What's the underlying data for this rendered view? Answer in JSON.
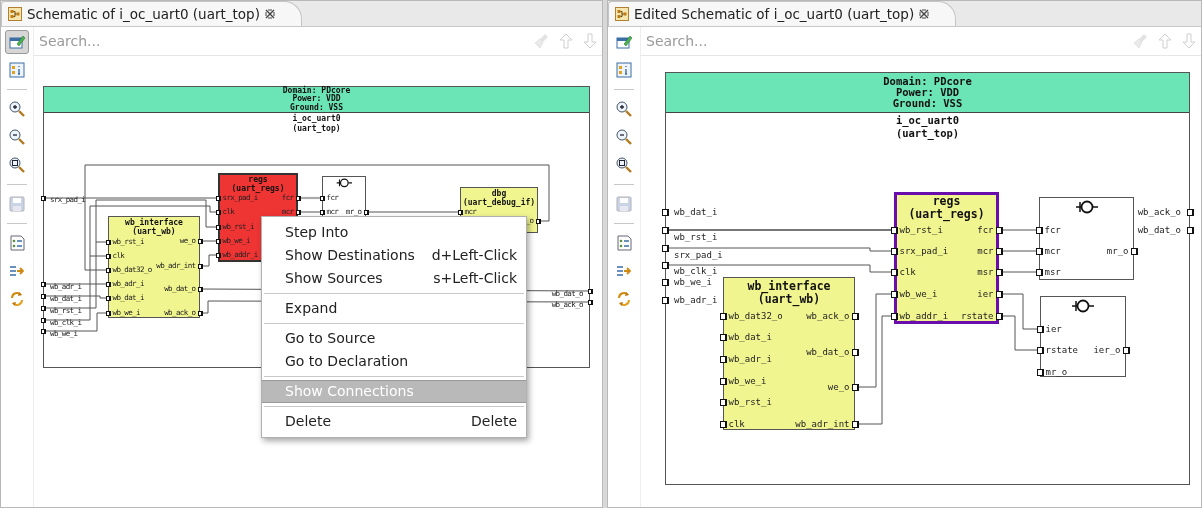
{
  "panes": [
    {
      "title": "Schematic of i_oc_uart0 (uart_top)",
      "search": {
        "placeholder": "Search..."
      },
      "search_tools": [
        {
          "kind": "clear",
          "disabled": true
        },
        {
          "kind": "up",
          "disabled": true
        },
        {
          "kind": "down",
          "disabled": true
        }
      ],
      "tools": [
        {
          "kind": "edit",
          "pressed": true,
          "disabled": false
        },
        {
          "kind": "info",
          "pressed": false,
          "disabled": false
        },
        {
          "kind": "separator"
        },
        {
          "kind": "zoom-in",
          "pressed": false,
          "disabled": false
        },
        {
          "kind": "zoom-out",
          "pressed": false,
          "disabled": false
        },
        {
          "kind": "zoom-fit",
          "pressed": false,
          "disabled": false
        },
        {
          "kind": "separator"
        },
        {
          "kind": "save",
          "pressed": false,
          "disabled": true
        },
        {
          "kind": "separator"
        },
        {
          "kind": "report",
          "pressed": false,
          "disabled": false
        },
        {
          "kind": "step",
          "pressed": false,
          "disabled": false
        },
        {
          "kind": "sync",
          "pressed": false,
          "disabled": false
        }
      ],
      "schematic": {
        "domain": [
          "Domain: PDcore",
          "Power: VDD",
          "Ground: VSS"
        ],
        "instance": [
          "i_oc_uart0",
          "(uart_top)"
        ],
        "inputs": [
          "srx_pad_i",
          "wb_adr_i",
          "wb_dat_i",
          "wb_rst_i",
          "wb_clk_i",
          "wb_we_i"
        ],
        "outputs": [
          "wb_dat_o",
          "wb_ack_o"
        ],
        "blocks": [
          {
            "kind": "module",
            "highlighted": true,
            "selected": false,
            "title": "regs",
            "subtitle": "(uart_regs)",
            "inputs": [
              "srx_pad_i",
              "clk",
              "wb_rst_i",
              "wb_we_i",
              "wb_addr_i"
            ],
            "outputs": [
              "fcr",
              "mcr"
            ]
          },
          {
            "kind": "primitive",
            "highlighted": false,
            "selected": false,
            "inputs": [
              "fcr",
              "mcr"
            ],
            "outputs": [
              "mr_o"
            ]
          },
          {
            "kind": "module",
            "highlighted": false,
            "selected": false,
            "title": "dbg",
            "subtitle": "(uart_debug_if)",
            "inputs": [
              "mcr"
            ],
            "outputs": [
              "_o"
            ]
          },
          {
            "kind": "module",
            "highlighted": false,
            "selected": false,
            "title": "wb_interface",
            "subtitle": "(uart_wb)",
            "inputs": [
              "wb_rst_i",
              "clk",
              "wb_dat32_o",
              "wb_adr_i",
              "wb_dat_i",
              "wb_we_i"
            ],
            "outputs": [
              "we_o",
              "wb_adr_int",
              "wb_dat_o",
              "wb_ack_o"
            ]
          }
        ]
      }
    },
    {
      "title": "Edited Schematic of i_oc_uart0 (uart_top)",
      "search": {
        "placeholder": "Search..."
      },
      "search_tools": [
        {
          "kind": "clear",
          "disabled": true
        },
        {
          "kind": "up",
          "disabled": true
        },
        {
          "kind": "down",
          "disabled": true
        }
      ],
      "tools": [
        {
          "kind": "edit",
          "pressed": false,
          "disabled": false
        },
        {
          "kind": "info",
          "pressed": false,
          "disabled": false
        },
        {
          "kind": "separator"
        },
        {
          "kind": "zoom-in",
          "pressed": false,
          "disabled": false
        },
        {
          "kind": "zoom-out",
          "pressed": false,
          "disabled": false
        },
        {
          "kind": "zoom-fit",
          "pressed": false,
          "disabled": false
        },
        {
          "kind": "separator"
        },
        {
          "kind": "save",
          "pressed": false,
          "disabled": true
        },
        {
          "kind": "separator"
        },
        {
          "kind": "report",
          "pressed": false,
          "disabled": false
        },
        {
          "kind": "step",
          "pressed": false,
          "disabled": false
        },
        {
          "kind": "sync",
          "pressed": false,
          "disabled": false
        }
      ],
      "schematic": {
        "domain": [
          "Domain: PDcore",
          "Power: VDD",
          "Ground: VSS"
        ],
        "instance": [
          "i_oc_uart0",
          "(uart_top)"
        ],
        "inputs": [
          "wb_dat_i",
          "wb_rst_i",
          "srx_pad_i",
          "wb_clk_i",
          "wb_we_i",
          "wb_adr_i"
        ],
        "outputs": [
          "wb_ack_o",
          "wb_dat_o"
        ],
        "blocks": [
          {
            "kind": "module",
            "highlighted": false,
            "selected": true,
            "title": "regs",
            "subtitle": "(uart_regs)",
            "inputs": [
              "wb_rst_i",
              "srx_pad_i",
              "clk",
              "wb_we_i",
              "wb_addr_i"
            ],
            "outputs": [
              "fcr",
              "mcr",
              "msr",
              "ier",
              "rstate"
            ]
          },
          {
            "kind": "primitive",
            "highlighted": false,
            "selected": false,
            "inputs": [
              "fcr",
              "mcr",
              "msr"
            ],
            "outputs": [
              "mr_o"
            ]
          },
          {
            "kind": "module",
            "highlighted": false,
            "selected": false,
            "title": "wb_interface",
            "subtitle": "(uart_wb)",
            "inputs": [
              "wb_dat32_o",
              "wb_dat_i",
              "wb_adr_i",
              "wb_we_i",
              "wb_rst_i",
              "clk"
            ],
            "outputs": [
              "wb_ack_o",
              "wb_dat_o",
              "we_o",
              "wb_adr_int"
            ]
          },
          {
            "kind": "primitive",
            "highlighted": false,
            "selected": false,
            "inputs": [
              "ier",
              "rstate",
              "mr_o"
            ],
            "outputs": [
              "ier_o"
            ]
          }
        ]
      }
    }
  ],
  "context_menu": {
    "items": [
      {
        "kind": "item",
        "label": "Step Into",
        "selected": false
      },
      {
        "kind": "item",
        "label": "Show Destinations",
        "shortcut": "d+Left-Click",
        "selected": false
      },
      {
        "kind": "item",
        "label": "Show Sources",
        "shortcut": "s+Left-Click",
        "selected": false
      },
      {
        "kind": "separator"
      },
      {
        "kind": "item",
        "label": "Expand",
        "selected": false
      },
      {
        "kind": "separator"
      },
      {
        "kind": "item",
        "label": "Go to Source",
        "selected": false
      },
      {
        "kind": "item",
        "label": "Go to Declaration",
        "selected": false
      },
      {
        "kind": "separator"
      },
      {
        "kind": "item",
        "label": "Show Connections",
        "selected": true
      },
      {
        "kind": "separator"
      },
      {
        "kind": "item",
        "label": "Delete",
        "shortcut": "Delete",
        "selected": false
      }
    ]
  }
}
